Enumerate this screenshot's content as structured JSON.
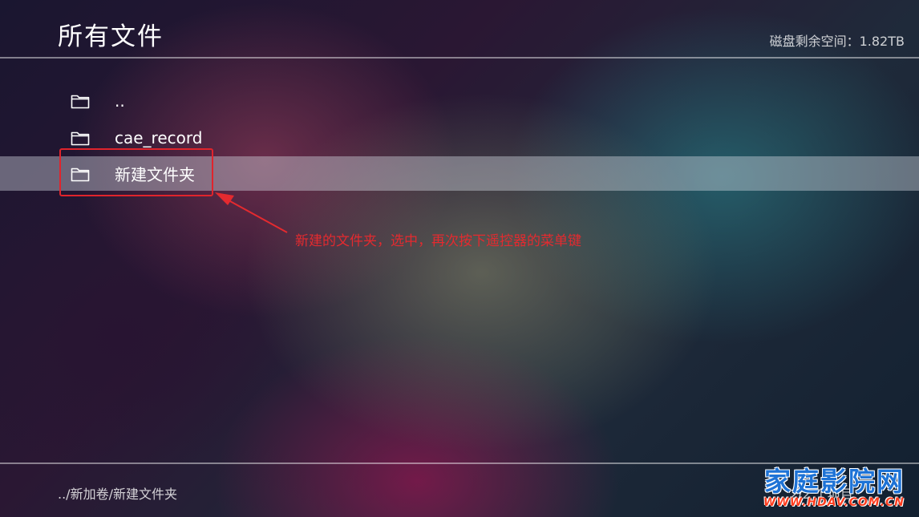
{
  "header": {
    "title": "所有文件",
    "disk_space": "磁盘剩余空间：1.82TB"
  },
  "files": [
    {
      "name": "..",
      "icon": "folder-icon"
    },
    {
      "name": "cae_record",
      "icon": "folder-icon"
    },
    {
      "name": "新建文件夹",
      "icon": "folder-icon",
      "selected": true
    }
  ],
  "annotation": {
    "text": "新建的文件夹，选中，再次按下遥控器的菜单键",
    "color": "#e42a2f"
  },
  "footer": {
    "path": "../新加卷/新建文件夹",
    "item_count": "2/2 个项目"
  },
  "watermark": {
    "main": "家庭影院网",
    "sub": "WWW.HDAV.COM.CN"
  }
}
